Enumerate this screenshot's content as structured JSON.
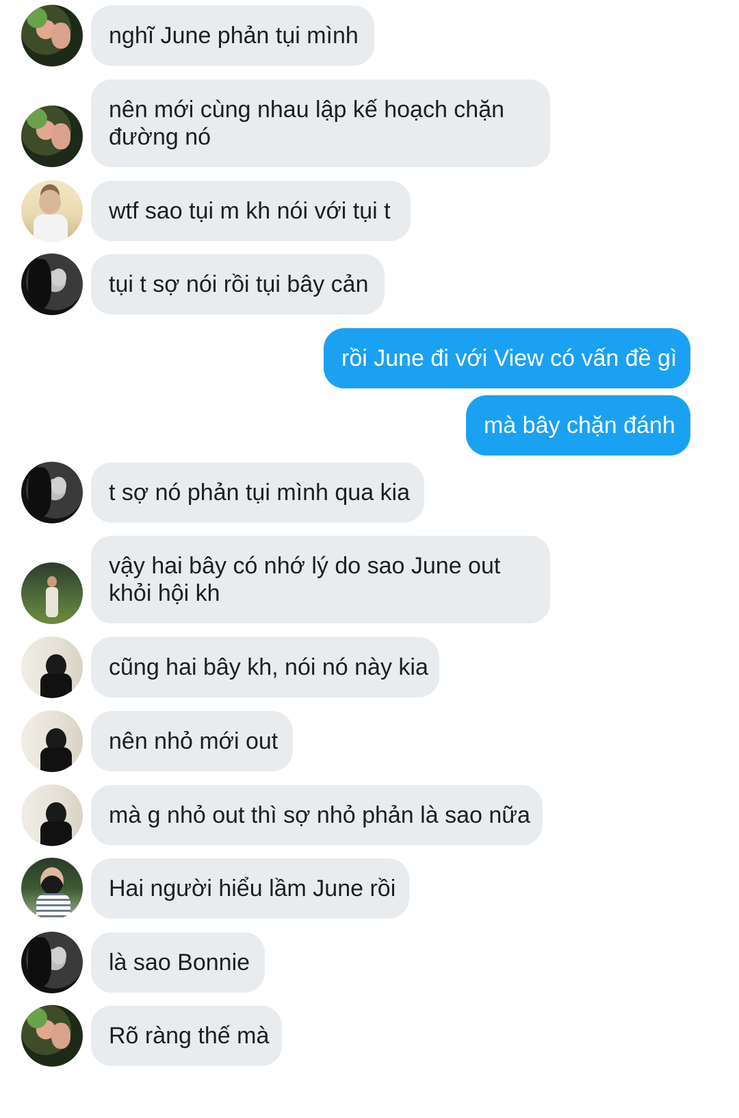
{
  "messages": [
    {
      "text": "nghĩ June phản tụi mình",
      "avatar": "avatar-a"
    },
    {
      "text": "nên mới cùng nhau lập kế hoạch chặn đường nó",
      "avatar": "avatar-a"
    },
    {
      "text": "wtf sao tụi m kh nói với tụi t",
      "avatar": "avatar-b"
    },
    {
      "text": "tụi t sợ nói rồi tụi bây cản",
      "avatar": "avatar-c"
    },
    {
      "text": "rồi June đi với View có vấn đề gì",
      "outgoing": true
    },
    {
      "text": "mà bây chặn đánh",
      "outgoing": true
    },
    {
      "text": "t sợ nó phản tụi mình qua kia",
      "avatar": "avatar-c"
    },
    {
      "text": "vậy hai bây có nhớ lý do sao June out khỏi hội kh",
      "avatar": "avatar-d"
    },
    {
      "text": "cũng hai bây kh, nói nó này kia",
      "avatar": "avatar-e"
    },
    {
      "text": "nên nhỏ mới out",
      "avatar": "avatar-e"
    },
    {
      "text": "mà g nhỏ out thì sợ nhỏ phản là sao nữa",
      "avatar": "avatar-e"
    },
    {
      "text": "Hai người hiểu lầm June rồi",
      "avatar": "avatar-f"
    },
    {
      "text": "là sao Bonnie",
      "avatar": "avatar-c"
    },
    {
      "text": "Rõ ràng thế mà",
      "avatar": "avatar-a"
    }
  ],
  "colors": {
    "incoming_bubble": "#e9ecef",
    "outgoing_bubble": "#1ba1f2",
    "incoming_text": "#1c1e21",
    "outgoing_text": "#ffffff"
  }
}
